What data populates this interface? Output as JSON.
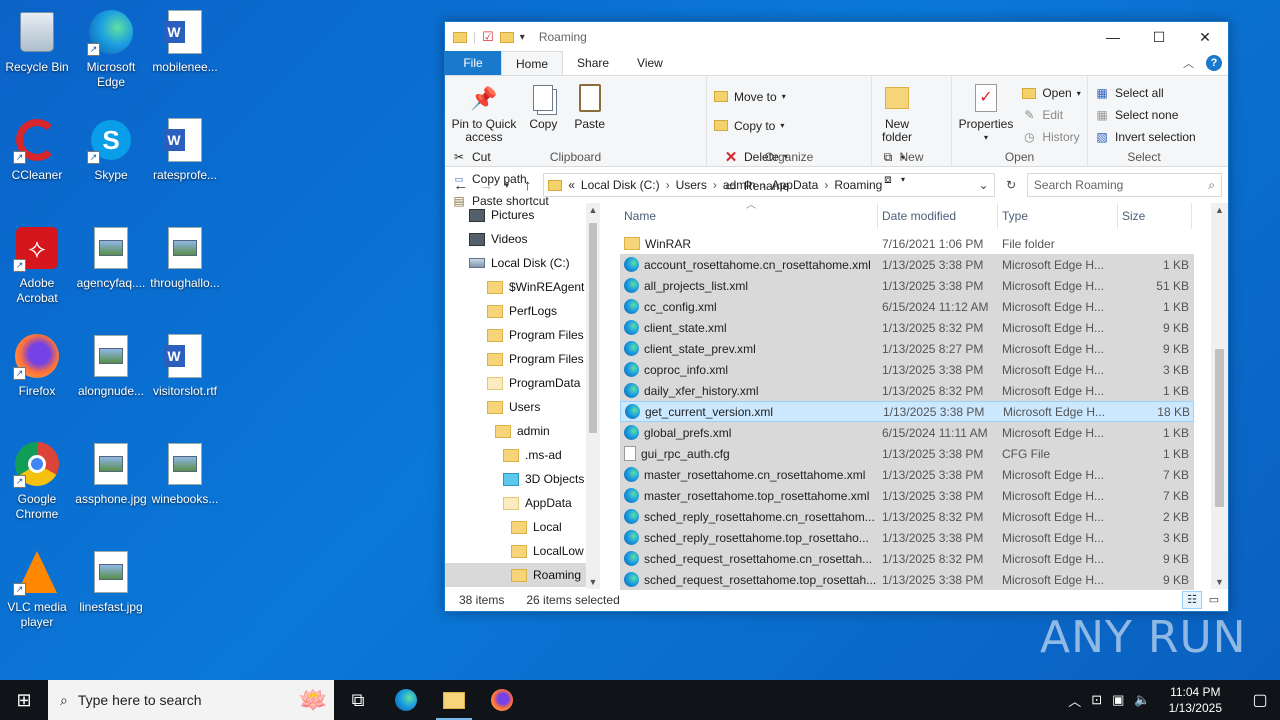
{
  "desktop": {
    "icons": [
      {
        "label": "Recycle Bin"
      },
      {
        "label": "Microsoft Edge"
      },
      {
        "label": "mobilenee..."
      },
      {
        "label": "CCleaner"
      },
      {
        "label": "Skype"
      },
      {
        "label": "ratesprofe..."
      },
      {
        "label": "Adobe Acrobat"
      },
      {
        "label": "agencyfaq...."
      },
      {
        "label": "throughallo..."
      },
      {
        "label": "Firefox"
      },
      {
        "label": "alongnude..."
      },
      {
        "label": "visitorslot.rtf"
      },
      {
        "label": "Google Chrome"
      },
      {
        "label": "assphone.jpg"
      },
      {
        "label": "winebooks..."
      },
      {
        "label": "VLC media player"
      },
      {
        "label": "linesfast.jpg"
      }
    ]
  },
  "window": {
    "title": "Roaming",
    "controls": {
      "minimize": "—",
      "maximize": "☐",
      "close": "✕"
    },
    "tabs": [
      {
        "label": "File"
      },
      {
        "label": "Home"
      },
      {
        "label": "Share"
      },
      {
        "label": "View"
      }
    ],
    "help": "?",
    "ribbon": {
      "clipboard": {
        "pin": "Pin to Quick access",
        "copy": "Copy",
        "paste": "Paste",
        "cut": "Cut",
        "copy_path": "Copy path",
        "paste_shortcut": "Paste shortcut",
        "label": "Clipboard"
      },
      "organize": {
        "move_to": "Move to",
        "copy_to": "Copy to",
        "delete": "Delete",
        "rename": "Rename",
        "label": "Organize"
      },
      "new": {
        "new_folder": "New folder",
        "label": "New"
      },
      "open": {
        "properties": "Properties",
        "open": "Open",
        "edit": "Edit",
        "history": "History",
        "label": "Open"
      },
      "select": {
        "select_all": "Select all",
        "select_none": "Select none",
        "invert": "Invert selection",
        "label": "Select"
      }
    },
    "address": {
      "prefix": "«",
      "crumbs": [
        "Local Disk (C:)",
        "Users",
        "admin",
        "AppData",
        "Roaming"
      ]
    },
    "search_placeholder": "Search Roaming",
    "nav_pane": [
      {
        "label": "Pictures",
        "icon": "dark",
        "indent": 1
      },
      {
        "label": "Videos",
        "icon": "dark",
        "indent": 1
      },
      {
        "label": "Local Disk (C:)",
        "icon": "drive",
        "indent": 1
      },
      {
        "label": "$WinREAgent",
        "icon": "folder",
        "indent": 2
      },
      {
        "label": "PerfLogs",
        "icon": "folder",
        "indent": 2
      },
      {
        "label": "Program Files",
        "icon": "folder",
        "indent": 2
      },
      {
        "label": "Program Files",
        "icon": "folder",
        "indent": 2
      },
      {
        "label": "ProgramData",
        "icon": "light",
        "indent": 2
      },
      {
        "label": "Users",
        "icon": "folder",
        "indent": 2
      },
      {
        "label": "admin",
        "icon": "folder",
        "indent": 3
      },
      {
        "label": ".ms-ad",
        "icon": "folder",
        "indent": 4
      },
      {
        "label": "3D Objects",
        "icon": "cube",
        "indent": 4
      },
      {
        "label": "AppData",
        "icon": "light",
        "indent": 4
      },
      {
        "label": "Local",
        "icon": "folder",
        "indent": 5
      },
      {
        "label": "LocalLow",
        "icon": "folder",
        "indent": 5
      },
      {
        "label": "Roaming",
        "icon": "folder",
        "indent": 5,
        "selected": true
      }
    ],
    "columns": [
      "Name",
      "Date modified",
      "Type",
      "Size"
    ],
    "files": [
      {
        "name": "WinRAR",
        "date": "7/16/2021 1:06 PM",
        "type": "File folder",
        "size": "",
        "icon": "folder",
        "state": "none"
      },
      {
        "name": "account_rosettahome.cn_rosettahome.xml",
        "date": "1/13/2025 3:38 PM",
        "type": "Microsoft Edge H...",
        "size": "1 KB",
        "icon": "edge",
        "state": "sel"
      },
      {
        "name": "all_projects_list.xml",
        "date": "1/13/2025 3:38 PM",
        "type": "Microsoft Edge H...",
        "size": "51 KB",
        "icon": "edge",
        "state": "sel"
      },
      {
        "name": "cc_config.xml",
        "date": "6/15/2024 11:12 AM",
        "type": "Microsoft Edge H...",
        "size": "1 KB",
        "icon": "edge",
        "state": "sel"
      },
      {
        "name": "client_state.xml",
        "date": "1/13/2025 8:32 PM",
        "type": "Microsoft Edge H...",
        "size": "9 KB",
        "icon": "edge",
        "state": "sel"
      },
      {
        "name": "client_state_prev.xml",
        "date": "1/13/2025 8:27 PM",
        "type": "Microsoft Edge H...",
        "size": "9 KB",
        "icon": "edge",
        "state": "sel"
      },
      {
        "name": "coproc_info.xml",
        "date": "1/13/2025 3:38 PM",
        "type": "Microsoft Edge H...",
        "size": "3 KB",
        "icon": "edge",
        "state": "sel"
      },
      {
        "name": "daily_xfer_history.xml",
        "date": "1/13/2025 8:32 PM",
        "type": "Microsoft Edge H...",
        "size": "1 KB",
        "icon": "edge",
        "state": "sel"
      },
      {
        "name": "get_current_version.xml",
        "date": "1/13/2025 3:38 PM",
        "type": "Microsoft Edge H...",
        "size": "18 KB",
        "icon": "edge",
        "state": "focus"
      },
      {
        "name": "global_prefs.xml",
        "date": "6/15/2024 11:11 AM",
        "type": "Microsoft Edge H...",
        "size": "1 KB",
        "icon": "edge",
        "state": "sel"
      },
      {
        "name": "gui_rpc_auth.cfg",
        "date": "1/13/2025 3:38 PM",
        "type": "CFG File",
        "size": "1 KB",
        "icon": "cfg",
        "state": "sel"
      },
      {
        "name": "master_rosettahome.cn_rosettahome.xml",
        "date": "1/13/2025 3:38 PM",
        "type": "Microsoft Edge H...",
        "size": "7 KB",
        "icon": "edge",
        "state": "sel"
      },
      {
        "name": "master_rosettahome.top_rosettahome.xml",
        "date": "1/13/2025 3:38 PM",
        "type": "Microsoft Edge H...",
        "size": "7 KB",
        "icon": "edge",
        "state": "sel"
      },
      {
        "name": "sched_reply_rosettahome.cn_rosettahom...",
        "date": "1/13/2025 8:32 PM",
        "type": "Microsoft Edge H...",
        "size": "2 KB",
        "icon": "edge",
        "state": "sel"
      },
      {
        "name": "sched_reply_rosettahome.top_rosettaho...",
        "date": "1/13/2025 3:38 PM",
        "type": "Microsoft Edge H...",
        "size": "3 KB",
        "icon": "edge",
        "state": "sel"
      },
      {
        "name": "sched_request_rosettahome.cn_rosettah...",
        "date": "1/13/2025 8:32 PM",
        "type": "Microsoft Edge H...",
        "size": "9 KB",
        "icon": "edge",
        "state": "sel"
      },
      {
        "name": "sched_request_rosettahome.top_rosettah...",
        "date": "1/13/2025 3:38 PM",
        "type": "Microsoft Edge H...",
        "size": "9 KB",
        "icon": "edge",
        "state": "sel"
      }
    ],
    "status": {
      "items": "38 items",
      "selected": "26 items selected"
    }
  },
  "taskbar": {
    "search_placeholder": "Type here to search",
    "time": "11:04 PM",
    "date": "1/13/2025"
  },
  "watermark": "ANY RUN",
  "colors": {
    "accent": "#1979ca",
    "selection": "#d9d9d9",
    "focus": "#cce8ff",
    "taskbar": "#101317"
  }
}
